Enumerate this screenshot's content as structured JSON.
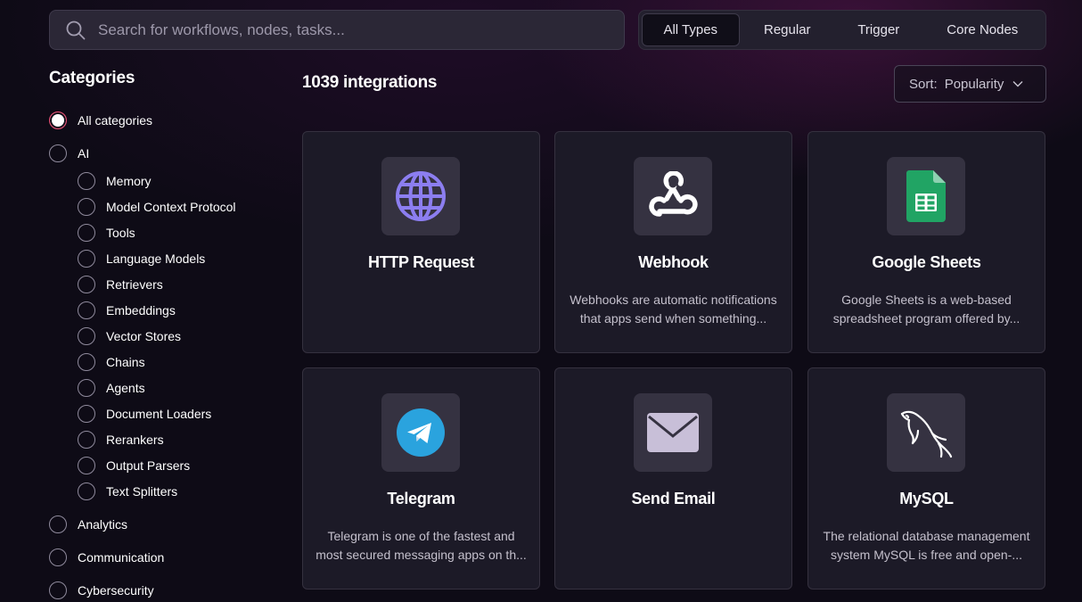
{
  "search": {
    "placeholder": "Search for workflows, nodes, tasks..."
  },
  "type_filter": {
    "tabs": [
      "All Types",
      "Regular",
      "Trigger",
      "Core Nodes"
    ],
    "active": "All Types"
  },
  "sidebar": {
    "title": "Categories",
    "categories": [
      "All categories",
      "AI",
      "Memory",
      "Model Context Protocol",
      "Tools",
      "Language Models",
      "Retrievers",
      "Embeddings",
      "Vector Stores",
      "Chains",
      "Agents",
      "Document Loaders",
      "Rerankers",
      "Output Parsers",
      "Text Splitters",
      "Analytics",
      "Communication",
      "Cybersecurity"
    ],
    "selected": "All categories"
  },
  "results": {
    "count_label": "1039 integrations",
    "sort_label": "Sort:",
    "sort_value": "Popularity"
  },
  "cards": [
    {
      "name": "HTTP Request",
      "icon": "globe-icon",
      "desc1": "",
      "desc2": ""
    },
    {
      "name": "Webhook",
      "icon": "webhook-icon",
      "desc1": "Webhooks are automatic notifications",
      "desc2": "that apps send when something..."
    },
    {
      "name": "Google Sheets",
      "icon": "google-sheets-icon",
      "desc1": "Google Sheets is a web-based",
      "desc2": "spreadsheet program offered by..."
    },
    {
      "name": "Telegram",
      "icon": "telegram-icon",
      "desc1": "Telegram is one of the fastest and",
      "desc2": "most secured messaging apps on th..."
    },
    {
      "name": "Send Email",
      "icon": "envelope-icon",
      "desc1": "",
      "desc2": ""
    },
    {
      "name": "MySQL",
      "icon": "mysql-dolphin-icon",
      "desc1": "The relational database management",
      "desc2": "system MySQL is free and open-..."
    }
  ],
  "colors": {
    "background": "#0e0b16",
    "card": "#1c1a27",
    "accent": "#ea4b71",
    "globe": "#8c7ef0",
    "sheets": "#21a464",
    "telegram": "#2aa3de"
  }
}
